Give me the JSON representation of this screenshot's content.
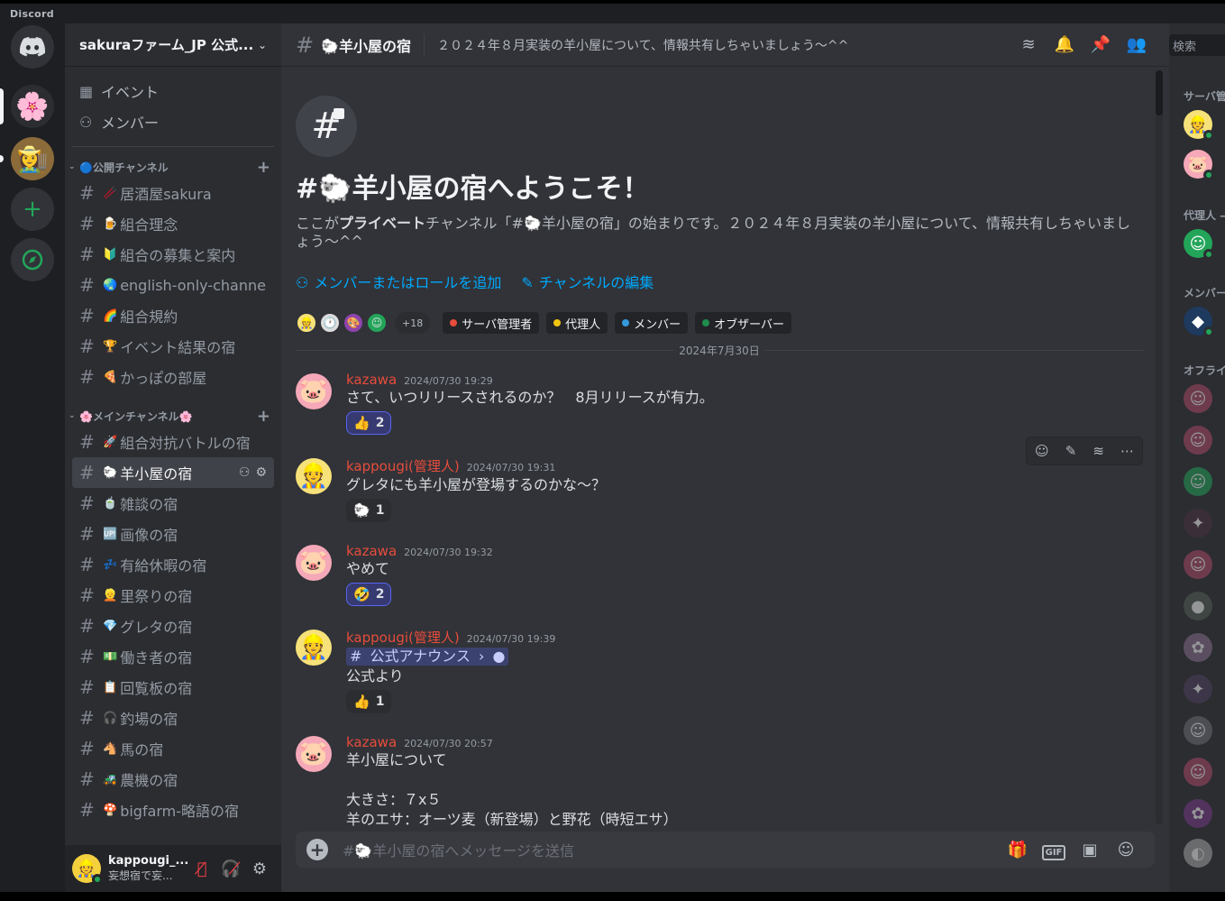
{
  "app": {
    "wordmark": "Discord"
  },
  "server": {
    "name": "sakuraファーム_JP 公式..."
  },
  "nav": [
    {
      "icon": "calendar-icon",
      "glyph": "▦",
      "label": "イベント"
    },
    {
      "icon": "members-icon",
      "glyph": "⚇",
      "label": "メンバー"
    }
  ],
  "categories": {
    "public": {
      "label": "🔵公開チャンネル"
    },
    "main": {
      "label": "🌸メインチャンネル🌸"
    }
  },
  "public_channels": [
    {
      "emoji": "🥢",
      "name": "居酒屋sakura"
    },
    {
      "emoji": "🍺",
      "name": "組合理念"
    },
    {
      "emoji": "🔰",
      "name": "組合の募集と案内"
    },
    {
      "emoji": "🌏",
      "name": "english-only-channel"
    },
    {
      "emoji": "🌈",
      "name": "組合規約"
    },
    {
      "emoji": "🏆",
      "name": "イベント結果の宿"
    },
    {
      "emoji": "🍕",
      "name": "かっぽの部屋"
    }
  ],
  "main_channels": [
    {
      "emoji": "🚀",
      "name": "組合対抗バトルの宿"
    },
    {
      "emoji": "🐑",
      "name": "羊小屋の宿",
      "active": true
    },
    {
      "emoji": "🍵",
      "name": "雑談の宿"
    },
    {
      "emoji": "🆙",
      "name": "画像の宿"
    },
    {
      "emoji": "💤",
      "name": "有給休暇の宿"
    },
    {
      "emoji": "👱",
      "name": "里祭りの宿"
    },
    {
      "emoji": "💎",
      "name": "グレタの宿"
    },
    {
      "emoji": "💵",
      "name": "働き者の宿"
    },
    {
      "emoji": "📋",
      "name": "回覧板の宿"
    },
    {
      "emoji": "🎧",
      "name": "釣場の宿"
    },
    {
      "emoji": "🐴",
      "name": "馬の宿"
    },
    {
      "emoji": "🚜",
      "name": "農機の宿"
    },
    {
      "emoji": "🍄",
      "name": "bigfarm-略語の宿"
    }
  ],
  "user": {
    "name": "kappougi_...",
    "status": "妄想宿で妄..."
  },
  "channel": {
    "name": "🐑羊小屋の宿",
    "topic": "２０２４年８月実装の羊小屋について、情報共有しちゃいましょう～^^"
  },
  "welcome": {
    "title": "#🐑羊小屋の宿へようこそ！",
    "desc_pre": "ここが",
    "desc_bold": "プライベート",
    "desc_post": "チャンネル「#🐑羊小屋の宿」の始まりです。２０２４年８月実装の羊小屋について、情報共有しちゃいましょう～^^",
    "add_link": "メンバーまたはロールを追加",
    "edit_link": "チャンネルの編集",
    "more_count": "+18",
    "roles": [
      {
        "label": "サーバ管理者",
        "color": "#e74c3c"
      },
      {
        "label": "代理人",
        "color": "#f1c40f"
      },
      {
        "label": "メンバー",
        "color": "#3498db"
      },
      {
        "label": "オブザーバー",
        "color": "#1f8b4c"
      }
    ]
  },
  "date_divider": "2024年7月30日",
  "messages": [
    {
      "author": "kazawa",
      "time": "2024/07/30 19:29",
      "lines": [
        "さて、いつリリースされるのか？　8月リリースが有力。"
      ],
      "reaction": {
        "emoji": "👍",
        "count": "2",
        "mine": true
      }
    },
    {
      "author": "kappougi(管理人)",
      "time": "2024/07/30 19:31",
      "lines": [
        "グレタにも羊小屋が登場するのかな～？"
      ],
      "reaction": {
        "emoji": "🐑",
        "count": "1",
        "mine": false
      }
    },
    {
      "author": "kazawa",
      "time": "2024/07/30 19:32",
      "lines": [
        "やめて"
      ],
      "reaction": {
        "emoji": "🤣",
        "count": "2",
        "mine": true
      }
    },
    {
      "author": "kappougi(管理人)",
      "time": "2024/07/30 19:39",
      "mention": "公式アナウンス",
      "lines": [
        "公式より"
      ],
      "reaction": {
        "emoji": "👍",
        "count": "1",
        "mine": false
      }
    },
    {
      "author": "kazawa",
      "time": "2024/07/30 20:57",
      "lines": [
        "羊小屋について",
        "",
        "大きさ：７x５",
        "羊のエサ：オーツ麦（新登場）と野花（時短エサ）"
      ]
    }
  ],
  "composer": {
    "placeholder": "#🐑羊小屋の宿へメッセージを送信",
    "gif": "GIF"
  },
  "member_list": {
    "search_placeholder": "検索",
    "groups": [
      "サーバ管",
      "代理人 —",
      "メンバー",
      "オフライ"
    ]
  },
  "colors": {
    "accent": "#5865f2",
    "link": "#00a8fc",
    "admin": "#e74c3c",
    "online": "#23a559"
  }
}
